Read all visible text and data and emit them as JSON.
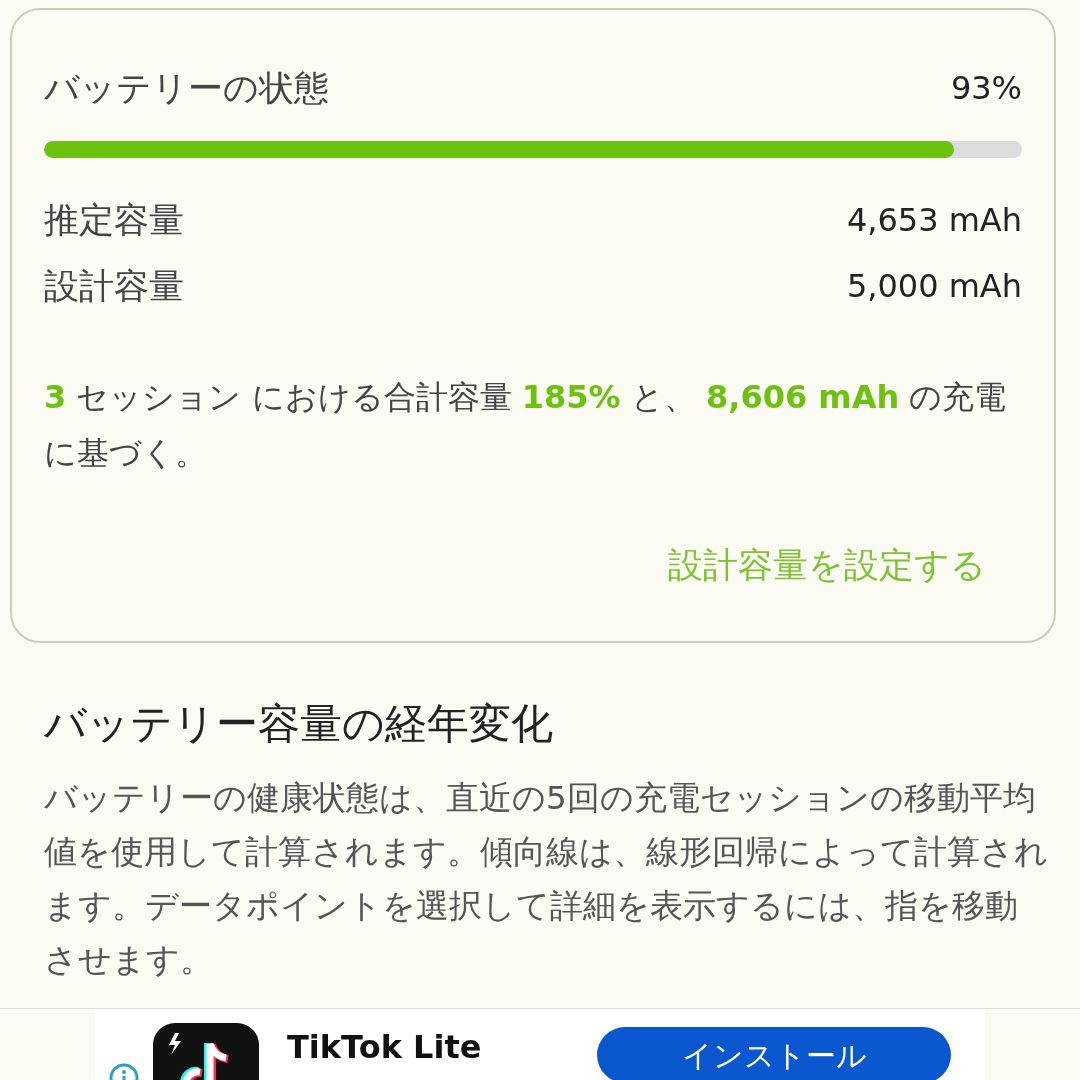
{
  "health": {
    "label": "バッテリーの状態",
    "value": "93%",
    "level": 0.93
  },
  "capacities": [
    {
      "label": "推定容量",
      "value": "4,653 mAh"
    },
    {
      "label": "設計容量",
      "value": "5,000 mAh"
    }
  ],
  "summary": "**3** セッション における合計容量 **185%** と、 **8,606 mAh** の充電に基づく。",
  "set_design_capacity_link": "設計容量を設定する",
  "section": {
    "title": "バッテリー容量の経年変化",
    "description": "バッテリーの健康状態は、直近の5回の充電セッションの移動平均値を使用して計算されます。傾向線は、線形回帰によって計算されます。データポイントを選択して詳細を表示するには、指を移動させます。"
  },
  "ad": {
    "app_name": "TikTok Lite",
    "button": "インストール"
  }
}
